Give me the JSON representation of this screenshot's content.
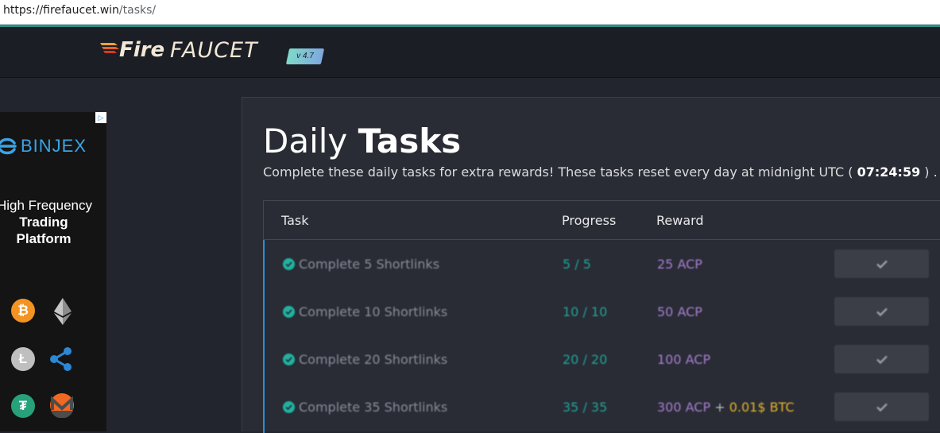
{
  "browser": {
    "url_host": "https://firefaucet.win",
    "url_path": "/tasks/"
  },
  "header": {
    "logo_fire": "Fire",
    "logo_faucet": "FAUCET",
    "version": "v 4.7"
  },
  "ad": {
    "brand": "BINJEX",
    "line1": "High Frequency",
    "line2": "Trading",
    "line3": "Platform",
    "adchoices_icon": "play-triangle-icon",
    "coins": [
      "bitcoin-icon",
      "ethereum-icon",
      "litecoin-icon",
      "ripple-icon",
      "tether-icon",
      "monero-icon"
    ]
  },
  "main": {
    "title_light": "Daily ",
    "title_bold": "Tasks",
    "subtitle_pre": "Complete these daily tasks for extra rewards! These tasks reset every day at midnight UTC ( ",
    "subtitle_time": "07:24:59",
    "subtitle_post": " ) .",
    "table": {
      "headers": [
        "Task",
        "Progress",
        "Reward"
      ],
      "rows": [
        {
          "task": "Complete 5 Shortlinks",
          "progress": "5 / 5",
          "reward": "25 ACP",
          "reward_extra_plus": "",
          "reward_extra": ""
        },
        {
          "task": "Complete 10 Shortlinks",
          "progress": "10 / 10",
          "reward": "50 ACP",
          "reward_extra_plus": "",
          "reward_extra": ""
        },
        {
          "task": "Complete 20 Shortlinks",
          "progress": "20 / 20",
          "reward": "100 ACP",
          "reward_extra_plus": "",
          "reward_extra": ""
        },
        {
          "task": "Complete 35 Shortlinks",
          "progress": "35 / 35",
          "reward": "300 ACP",
          "reward_extra_plus": " + ",
          "reward_extra": "0.01$ BTC"
        }
      ]
    }
  },
  "colors": {
    "accent_teal": "#1fa398",
    "reward_purple": "#a77fd1",
    "btc_gold": "#e6b52b",
    "row_border_blue": "#2a8fd6"
  }
}
